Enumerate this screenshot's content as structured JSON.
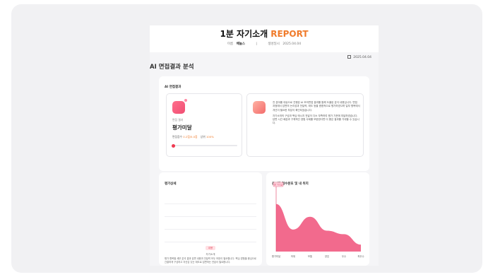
{
  "header": {
    "title_main": "1분 자기소개",
    "title_accent": "REPORT",
    "name_label": "이름",
    "name_value": "배놀스",
    "date_label": "생성일시",
    "date_value": "2025.04.04"
  },
  "report_date": "2025.04.04",
  "section_title": "AI 면접결과 분석",
  "main_card": {
    "label": "AI 면접결과",
    "sub_label": "면접 결과",
    "result": "평가미달",
    "score_prefix": "면접점수",
    "score_value": "0.2점/5.0점",
    "rank_prefix": "상위",
    "rank_value": "100%",
    "progress": 0.04,
    "paragraph1": "전 분야를 대상으로 진행된 AI 모의면접 결과를 통해 도출된 분석 내용입니다. 면접 과정에서 답변의 논리성과 전달력, 태도 등을 종합적으로 평가하였으며 일부 항목에서 개선이 필요한 부분이 확인되었습니다.",
    "paragraph2": "자기소개의 구성과 핵심 메시지 전달이 다소 부족하여 평가 기준에 미달하였습니다. 답변 시간 배분과 구체적인 경험 사례를 보완한다면 더 좋은 결과를 기대할 수 있습니다."
  },
  "eval_card": {
    "title": "평가상세",
    "badge": "내용",
    "badge_label": "자기소개",
    "text": "평가 항목별 세부 분석 결과 답변 내용과 전달력 모두 보완이 필요합니다. 핵심 경험을 중심으로 간결하게 구성하고 자신감 있는 태도로 답변하는 연습이 필요합니다."
  },
  "chart_card": {
    "title": "응시자 점수분포 및 내 위치"
  },
  "chart_data": {
    "type": "area",
    "title": "응시자 점수분포 및 내 위치",
    "x_categories": [
      "평가미달",
      "하위",
      "보통",
      "양호",
      "우수",
      "최우수"
    ],
    "values": [
      0.82,
      0.38,
      0.6,
      0.36,
      0.3,
      0.12
    ],
    "marker_label": "평가미달",
    "color": "#f26a8d"
  }
}
